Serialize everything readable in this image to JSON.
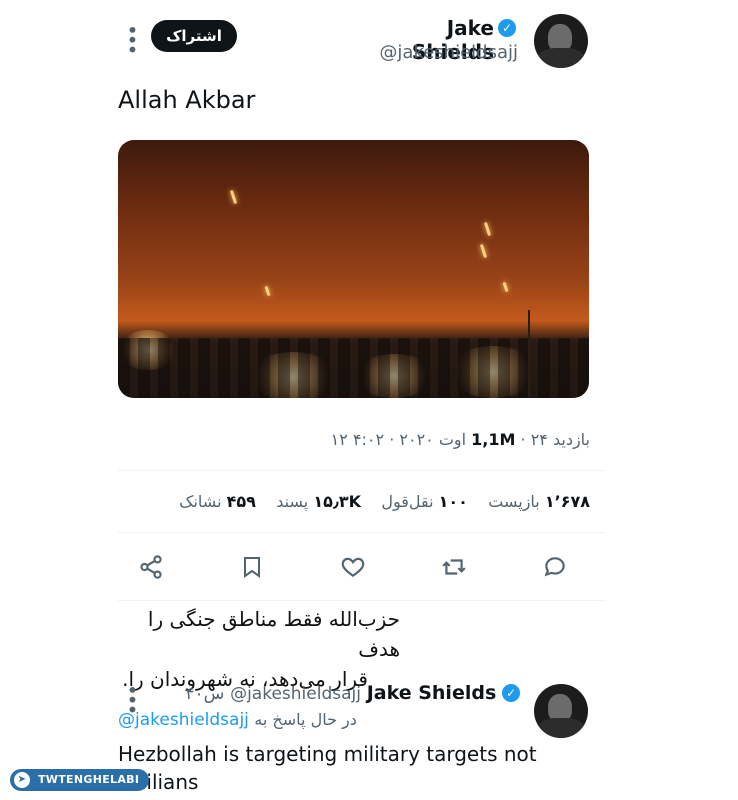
{
  "tweet": {
    "author_name": "Jake Shields",
    "author_handle": "@jakeshieldsajj",
    "subscribe_label": "اشتراک",
    "text": "Allah Akbar",
    "meta": {
      "date": "۲۴ اوت ۲۰۲۰ · ۴:۰۲ ۱۲",
      "views_count": "1,1M",
      "views_label": "بازدید"
    },
    "stats": {
      "reposts_count": "۱٬۶۷۸",
      "reposts_label": "بازپست",
      "quotes_count": "۱۰۰",
      "quotes_label": "نقل‌قول",
      "likes_count": "۱۵٫۳K",
      "likes_label": "پسند",
      "bookmarks_count": "۴۵۹",
      "bookmarks_label": "نشانک"
    }
  },
  "caption": {
    "line1": "حزب‌الله فقط مناطق جنگی را هدف",
    "line2": "قرار می‌دهد، نه شهروندان را."
  },
  "reply": {
    "author_name": "Jake Shields",
    "author_handle": "@jakeshieldsajj",
    "time": "۴۰س",
    "replying_to_label": "در حال پاسخ به",
    "replying_to_handle": "@jakeshieldsajj",
    "text": "Hezbollah is targeting military targets not civilians"
  },
  "watermark": {
    "label": "TWTENGHELABI"
  },
  "icons": [
    "verified-icon",
    "more-icon",
    "share-icon",
    "bookmark-icon",
    "like-icon",
    "repost-icon",
    "reply-icon",
    "telegram-icon"
  ],
  "colors": {
    "accent": "#1d9bf0",
    "text": "#0f1419",
    "muted": "#536471"
  }
}
